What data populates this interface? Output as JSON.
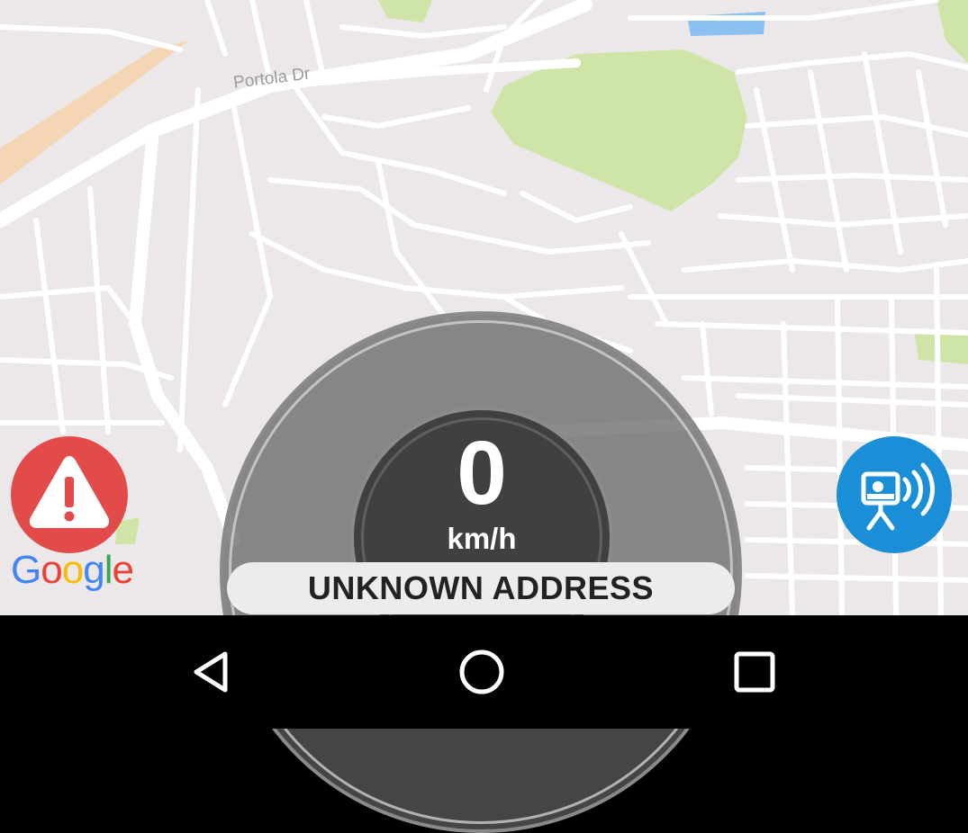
{
  "map": {
    "street_label": "Portola Dr",
    "attribution": "Google",
    "attribution_letters": [
      "G",
      "o",
      "o",
      "g",
      "l",
      "e"
    ],
    "attribution_colors": [
      "#4285F4",
      "#EA4335",
      "#FBBC05",
      "#4285F4",
      "#34A853",
      "#EA4335"
    ],
    "land_color": "#ece8ea",
    "road_color": "#ffffff",
    "park_color": "#cfe5a8",
    "water_color": "#8cc0f0"
  },
  "speedometer": {
    "speed": "0",
    "unit": "km/h",
    "address": "UNKNOWN ADDRESS"
  },
  "buttons": {
    "alert": {
      "icon": "warning-icon",
      "color": "#e34b4b"
    },
    "speed_camera": {
      "icon": "speed-camera-icon",
      "color": "#1a8fd8"
    }
  },
  "navigation_bar": {
    "back": "back-icon",
    "home": "home-icon",
    "recents": "recents-icon"
  }
}
